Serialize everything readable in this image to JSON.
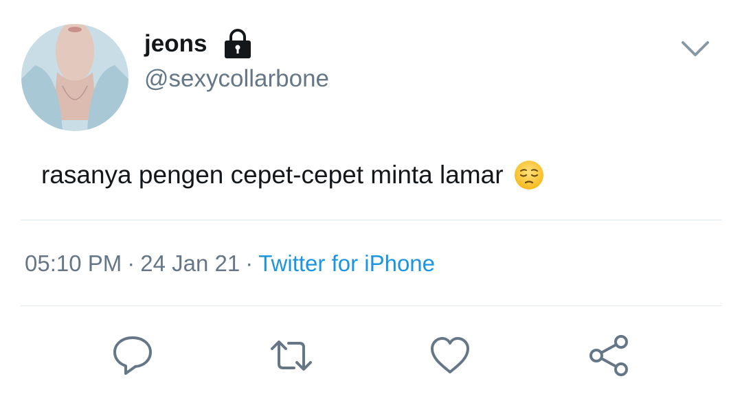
{
  "tweet": {
    "display_name": "jeons",
    "handle": "@sexycollarbone",
    "text": "rasanya pengen cepet-cepet minta lamar",
    "emoji": "pensive-face-emoji",
    "time": "05:10 PM",
    "date": "24 Jan 21",
    "source": "Twitter for iPhone",
    "separator": "·"
  },
  "icons": {
    "lock": "lock-icon",
    "menu": "chevron-down-icon",
    "reply": "reply-icon",
    "retweet": "retweet-icon",
    "like": "heart-icon",
    "share": "share-icon"
  },
  "colors": {
    "text": "#14171a",
    "muted": "#657786",
    "link": "#1b95e0",
    "divider": "#e1e8ed",
    "icon": "#657786"
  }
}
